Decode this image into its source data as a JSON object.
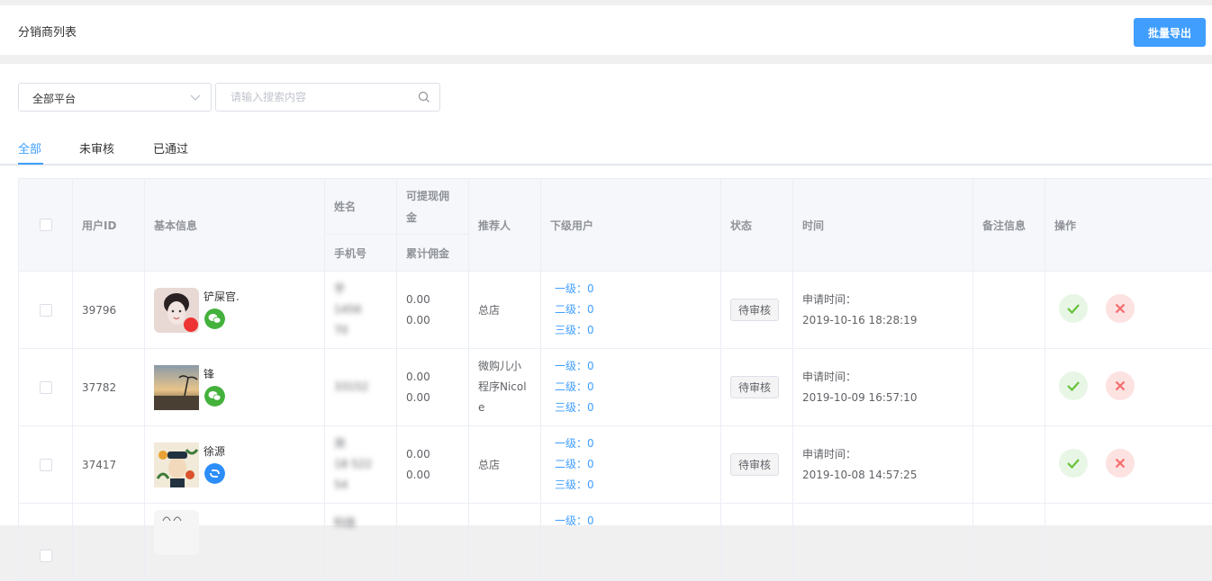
{
  "header": {
    "title": "分销商列表",
    "export_label": "批量导出"
  },
  "filter": {
    "platform": "全部平台",
    "search_placeholder": "请输入搜索内容"
  },
  "tabs": [
    "全部",
    "未审核",
    "已通过"
  ],
  "columns": {
    "user_id": "用户ID",
    "basic_info": "基本信息",
    "name": "姓名",
    "phone": "手机号",
    "withdrawable_line1": "可提现佣",
    "withdrawable_line2": "金",
    "total_commission": "累计佣金",
    "referrer": "推荐人",
    "sub_users": "下级用户",
    "status": "状态",
    "time": "时间",
    "remark": "备注信息",
    "actions": "操作"
  },
  "rows": [
    {
      "id": "39796",
      "nickname": "铲屎官.",
      "platform_icon": "wechat-icon",
      "name_lines": [
        "字",
        "1456",
        "70"
      ],
      "withdrawable": "0.00",
      "total": "0.00",
      "referrer_lines": [
        "总店"
      ],
      "sub": [
        "一级：0",
        "二级：0",
        "三级：0"
      ],
      "status": "待审核",
      "time_label": "申请时间：",
      "time": "2019-10-16 18:28:19"
    },
    {
      "id": "37782",
      "nickname": "锋",
      "platform_icon": "wechat-icon",
      "name_lines": [
        "",
        "33152",
        ""
      ],
      "withdrawable": "0.00",
      "total": "0.00",
      "referrer_lines": [
        "微购儿小",
        "程序Nicol",
        "e"
      ],
      "sub": [
        "一级：0",
        "二级：0",
        "三级：0"
      ],
      "status": "待审核",
      "time_label": "申请时间：",
      "time": "2019-10-09 16:57:10"
    },
    {
      "id": "37417",
      "nickname": "徐源",
      "platform_icon": "douyin-icon",
      "name_lines": [
        "测",
        "18 522",
        "54"
      ],
      "withdrawable": "0.00",
      "total": "0.00",
      "referrer_lines": [
        "总店"
      ],
      "sub": [
        "一级：0",
        "二级：0",
        "三级：0"
      ],
      "status": "待审核",
      "time_label": "申请时间：",
      "time": "2019-10-08 14:57:25"
    },
    {
      "id": "",
      "nickname": "",
      "name_lines": [
        "科技"
      ],
      "sub": [
        "一级：0"
      ]
    }
  ],
  "colors": {
    "accent": "#409eff",
    "approve": "#67c23a",
    "reject": "#f56c6c"
  }
}
